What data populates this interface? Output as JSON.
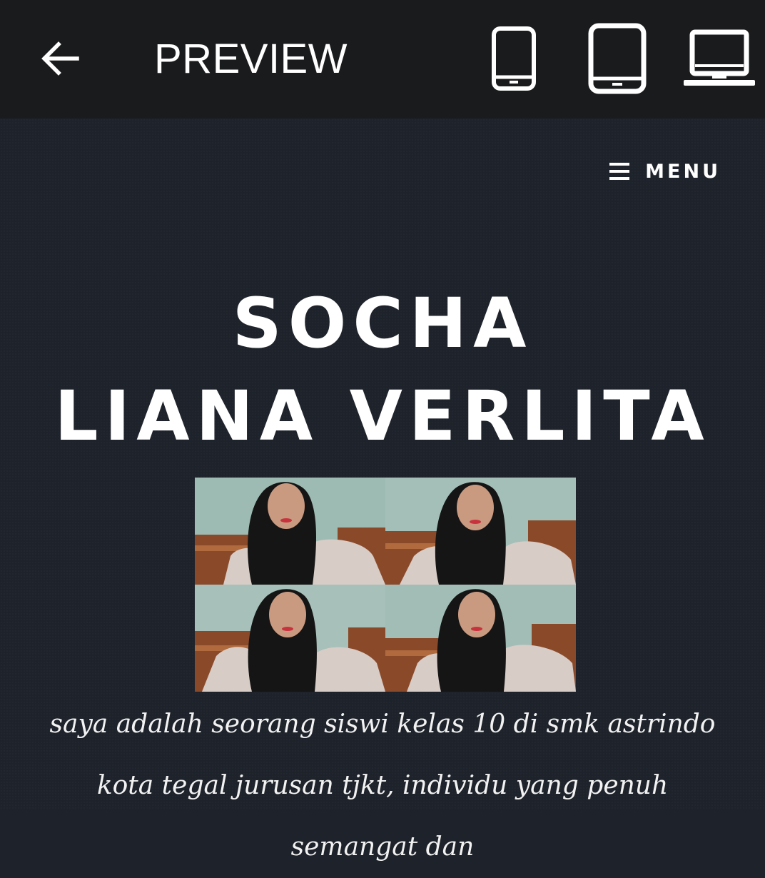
{
  "topbar": {
    "back_icon": "arrow-left-icon",
    "title": "PREVIEW",
    "devices": [
      {
        "name": "phone",
        "icon": "smartphone-icon"
      },
      {
        "name": "tablet",
        "icon": "tablet-icon"
      },
      {
        "name": "desktop",
        "icon": "laptop-icon"
      }
    ]
  },
  "site": {
    "menu": {
      "icon": "hamburger-icon",
      "label": "MENU"
    },
    "title_line1": "SOCHA",
    "title_line2": "LIANA VERLITA",
    "bio": "saya adalah seorang siswi kelas 10 di smk astrindo kota tegal jurusan tjkt, individu yang penuh semangat dan",
    "colors": {
      "topbar_bg": "#1a1b1d",
      "page_bg": "#1e232b",
      "text": "#ffffff"
    }
  }
}
